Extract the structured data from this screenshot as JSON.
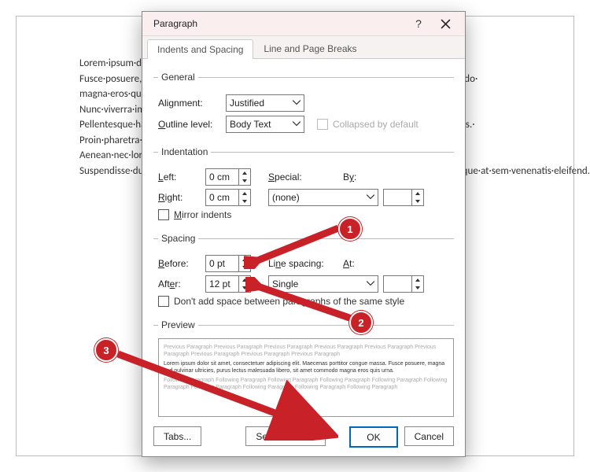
{
  "doc_text": "Lorem·ipsum·dolor·sit·amet,·consectetuer·adipiscing·elit.·Maecenas·porttitor·congue·massa.· Fusce·posuere,·magna·sed·pulvinar·ultricies,·purus·lectus·malesuada·libero,·sit·amet·commodo· magna·eros·quis·urna.¶\nNunc·viverra·imperdiet·enim.·Fusce·est.·Vivamus·a·tellus.¶\nPellentesque·habitant·morbi·tristique·senectus·et·netus·et·malesuada·fames·ac·turpis·egestas.· Proin·pharetra·nonummy·pede.·Mauris·et·orci.¶\nAenean·nec·lorem.·In·porttitor.·Donec·laoreet·nonummy·augue.¶\nSuspendisse·dui·purus,·scelerisque·at,·vulputate·vitae,·pretium·mattis,·nunc.·Mauris·eget·neque·at·sem·venenatis·eleifend.·Ut·nonummy.¶",
  "dialog": {
    "title": "Paragraph",
    "tabs": {
      "t1": "Indents and Spacing",
      "t2": "Line and Page Breaks"
    },
    "general": {
      "legend": "General",
      "alignment_label": "Alignment:",
      "alignment_value": "Justified",
      "outline_label": "Outline level:",
      "outline_value": "Body Text",
      "collapsed_label": "Collapsed by default"
    },
    "indent": {
      "legend": "Indentation",
      "left_label": "Left:",
      "left_value": "0 cm",
      "right_label": "Right:",
      "right_value": "0 cm",
      "special_label": "Special:",
      "special_value": "(none)",
      "by_label": "By:",
      "mirror_label": "Mirror indents"
    },
    "spacing": {
      "legend": "Spacing",
      "before_label": "Before:",
      "before_value": "0 pt",
      "after_label": "After:",
      "after_value": "12 pt",
      "line_label": "Line spacing:",
      "line_value": "Single",
      "at_label": "At:",
      "dontadd_label": "Don't add space between paragraphs of the same style"
    },
    "preview": {
      "legend": "Preview",
      "grey1": "Previous Paragraph Previous Paragraph Previous Paragraph Previous Paragraph Previous Paragraph Previous Paragraph Previous Paragraph Previous Paragraph Previous Paragraph",
      "main": "Lorem ipsum dolor sit amet, consectetuer adipiscing elit. Maecenas porttitor congue massa. Fusce posuere, magna sed pulvinar ultricies, purus lectus malesuada libero, sit amet commodo magna eros quis urna.",
      "grey2": "Following Paragraph Following Paragraph Following Paragraph Following Paragraph Following Paragraph Following Paragraph Following Paragraph Following Paragraph Following Paragraph Following Paragraph"
    },
    "buttons": {
      "tabs": "Tabs...",
      "default": "Set As Default",
      "ok": "OK",
      "cancel": "Cancel"
    }
  },
  "annotations": {
    "n1": "1",
    "n2": "2",
    "n3": "3"
  }
}
